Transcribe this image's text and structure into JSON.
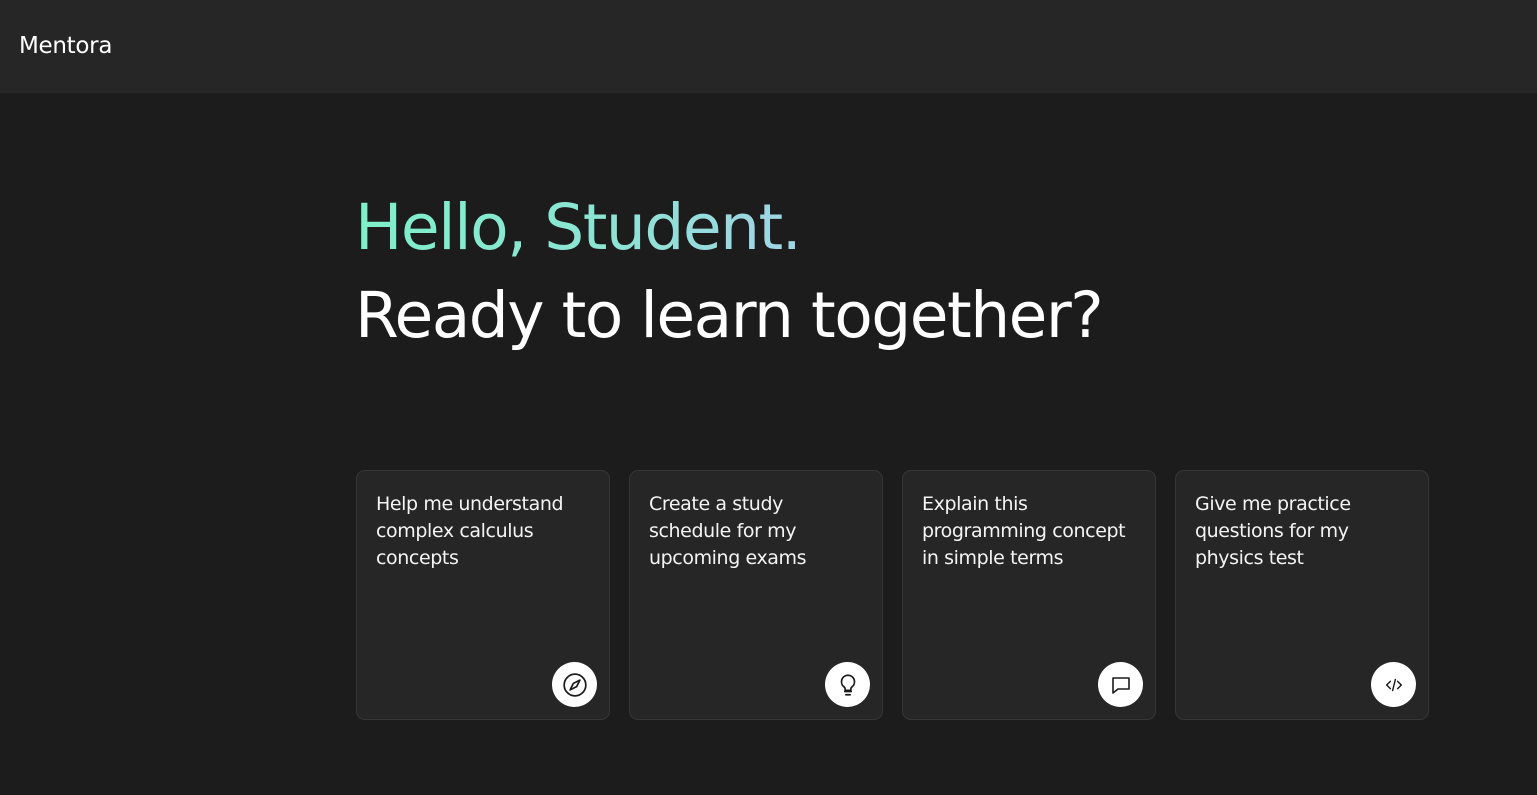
{
  "app": {
    "brand": "Mentora"
  },
  "hero": {
    "greeting": "Hello, Student.",
    "subheading": "Ready to learn together?"
  },
  "cards": [
    {
      "text": "Help me understand complex calculus concepts",
      "icon": "compass-icon"
    },
    {
      "text": "Create a study schedule for my upcoming exams",
      "icon": "lightbulb-icon"
    },
    {
      "text": "Explain this programming concept in simple terms",
      "icon": "message-icon"
    },
    {
      "text": "Give me practice questions for my physics test",
      "icon": "code-icon"
    }
  ],
  "colors": {
    "background": "#1c1c1c",
    "topbar": "#262626",
    "card": "#262626",
    "greeting_gradient_start": "#7ef0c9",
    "greeting_gradient_end": "#a2d3e6"
  }
}
